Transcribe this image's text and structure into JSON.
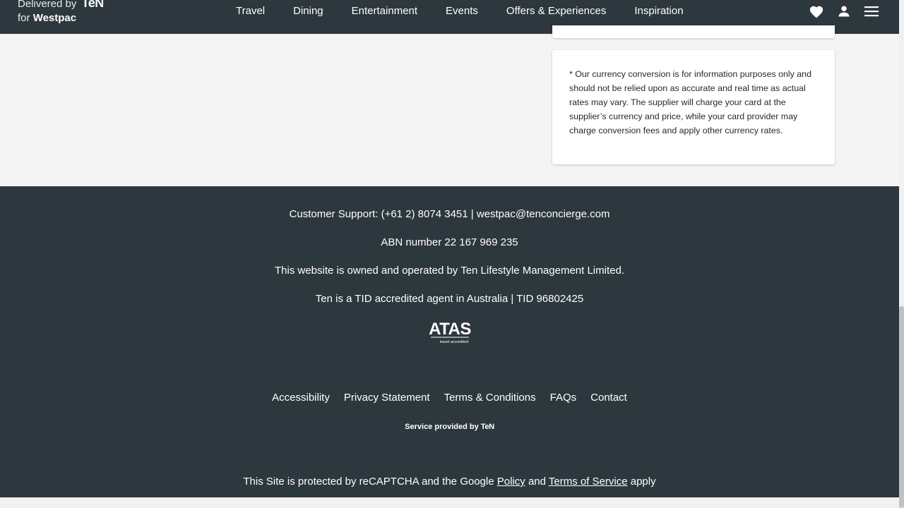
{
  "header": {
    "brand_line1": "Delivered by",
    "brand_ten": "TeN",
    "brand_for": "for",
    "brand_bank": "Westpac",
    "nav": [
      "Travel",
      "Dining",
      "Entertainment",
      "Events",
      "Offers & Experiences",
      "Inspiration"
    ],
    "icons": [
      "heart-icon",
      "user-icon",
      "menu-icon"
    ]
  },
  "note": {
    "text": "* Our currency conversion is for information purposes only and should not be relied upon as accurate and real time as actual rates may vary. The supplier will charge your card at the supplier’s currency and price, while your card provider may charge conversion fees and apply other currency rates."
  },
  "footer": {
    "support": "Customer Support: (+61 2) 8074 3451 | westpac@tenconcierge.com",
    "abn": "ABN number 22 167 969 235",
    "owned": "This website is owned and operated by Ten Lifestyle Management Limited.",
    "tid": "Ten is a TID accredited agent in Australia | TID 96802425",
    "atas_logo": "ATAS",
    "atas_sub": "travel accredited",
    "links": [
      "Accessibility",
      "Privacy Statement",
      "Terms & Conditions",
      "FAQs",
      "Contact"
    ],
    "service_prefix": "Service provided by",
    "service_ten": "TeN",
    "recaptcha_pre": "This Site is protected by reCAPTCHA and the Google",
    "recaptcha_policy": "Policy",
    "recaptcha_and": "and",
    "recaptcha_terms": "Terms of Service",
    "recaptcha_post": "apply"
  },
  "colors": {
    "header_bg": "#2d373e",
    "footer_bg": "#2d373e",
    "page_bg": "#f4f4f4",
    "card_bg": "#ffffff"
  }
}
